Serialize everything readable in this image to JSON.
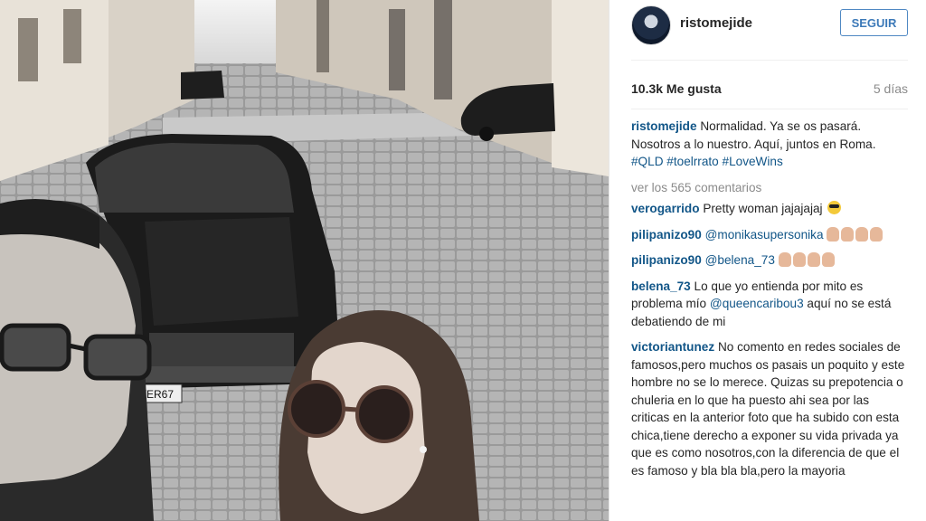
{
  "post": {
    "username": "ristomejide",
    "follow_label": "SEGUIR",
    "likes": "10.3k Me gusta",
    "age": "5 días",
    "caption_parts": [
      "Normalidad. Ya se os pasará. Nosotros a lo nuestro. Aquí, juntos en Roma. "
    ],
    "hashtags": [
      "#QLD",
      "#toelrrato",
      "#LoveWins"
    ],
    "view_comments": "ver los 565 comentarios",
    "license_plate": "RIVER67"
  },
  "comments": [
    {
      "user": "verogarrido",
      "text": "Pretty woman jajajajaj"
    },
    {
      "user": "pilipanizo90",
      "mention": "@monikasupersonika",
      "text": ""
    },
    {
      "user": "pilipanizo90",
      "mention": "@belena_73",
      "text": ""
    },
    {
      "user": "belena_73",
      "text_before": "Lo que yo entienda por mito es problema mío ",
      "mention": "@queencaribou3",
      "text_after": " aquí no se está debatiendo de mi"
    },
    {
      "user": "victoriantunez",
      "text": "No comento en redes sociales de famosos,pero muchos os pasais un poquito y este hombre no se lo merece. Quizas su prepotencia o chuleria en lo que ha puesto ahi sea por las criticas en la anterior foto que ha subido con esta chica,tiene derecho a exponer su vida privada ya que es como nosotros,con la diferencia de que el es famoso y bla bla bla,pero la mayoria"
    }
  ]
}
